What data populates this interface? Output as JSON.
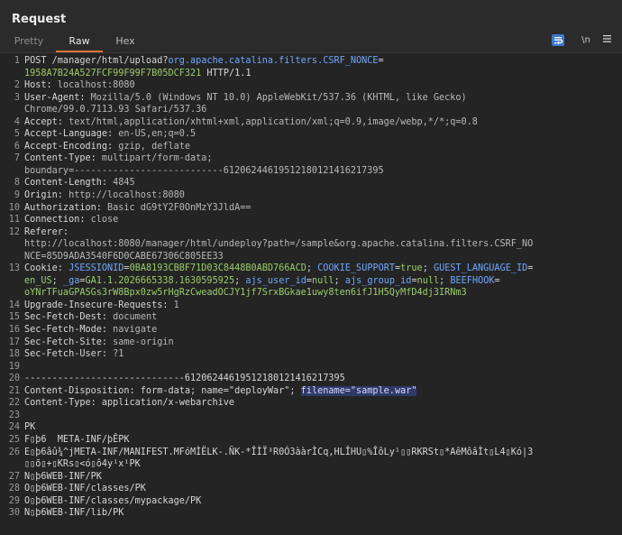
{
  "panel": {
    "title": "Request",
    "tabs": [
      "Pretty",
      "Raw",
      "Hex"
    ],
    "active_tab": "Raw",
    "newline_toggle": "\\n",
    "menu_icon": "hamburger-menu-icon",
    "wrap_icon": "word-wrap-icon"
  },
  "colors": {
    "accent": "#e8743b",
    "cookie_value": "#9acd68",
    "cookie_name": "#6fa7ff",
    "wrap_button": "#3c7ad1",
    "highlight": "#2f3a6a"
  },
  "lines": [
    {
      "n": "1",
      "parts": [
        {
          "t": "POST /manager/html/upload?"
        },
        {
          "t": "org.apache.catalina.filters.CSRF_NONCE",
          "c": "b"
        },
        {
          "t": "="
        }
      ]
    },
    {
      "n": "",
      "parts": [
        {
          "t": "1958A7B24A527FCF99F99F7B05DCF321",
          "c": "g"
        },
        {
          "t": " HTTP/1.1"
        }
      ]
    },
    {
      "n": "2",
      "parts": [
        {
          "t": "Host:",
          "c": "k"
        },
        {
          "t": " localhost:8080",
          "c": "v"
        }
      ]
    },
    {
      "n": "3",
      "parts": [
        {
          "t": "User-Agent:",
          "c": "k"
        },
        {
          "t": " Mozilla/5.0 (Windows NT 10.0) AppleWebKit/537.36 (KHTML, like Gecko)",
          "c": "v"
        }
      ]
    },
    {
      "n": "",
      "parts": [
        {
          "t": "Chrome/99.0.7113.93 Safari/537.36",
          "c": "v"
        }
      ]
    },
    {
      "n": "4",
      "parts": [
        {
          "t": "Accept:",
          "c": "k"
        },
        {
          "t": " text/html,application/xhtml+xml,application/xml;q=0.9,image/webp,*/*;q=0.8",
          "c": "v"
        }
      ]
    },
    {
      "n": "5",
      "parts": [
        {
          "t": "Accept-Language:",
          "c": "k"
        },
        {
          "t": " en-US,en;q=0.5",
          "c": "v"
        }
      ]
    },
    {
      "n": "6",
      "parts": [
        {
          "t": "Accept-Encoding:",
          "c": "k"
        },
        {
          "t": " gzip, deflate",
          "c": "v"
        }
      ]
    },
    {
      "n": "7",
      "parts": [
        {
          "t": "Content-Type:",
          "c": "k"
        },
        {
          "t": " multipart/form-data;",
          "c": "v"
        }
      ]
    },
    {
      "n": "",
      "parts": [
        {
          "t": "boundary=---------------------------6120624461951218012141621739​5",
          "c": "v"
        }
      ]
    },
    {
      "n": "8",
      "parts": [
        {
          "t": "Content-Length:",
          "c": "k"
        },
        {
          "t": " 4845",
          "c": "v"
        }
      ]
    },
    {
      "n": "9",
      "parts": [
        {
          "t": "Origin:",
          "c": "k"
        },
        {
          "t": " http://localhost:8080",
          "c": "v"
        }
      ]
    },
    {
      "n": "10",
      "parts": [
        {
          "t": "Authorization:",
          "c": "k"
        },
        {
          "t": " Basic dG9tY2F0OnMzY3JldA==",
          "c": "v"
        }
      ]
    },
    {
      "n": "11",
      "parts": [
        {
          "t": "Connection:",
          "c": "k"
        },
        {
          "t": " close",
          "c": "v"
        }
      ]
    },
    {
      "n": "12",
      "parts": [
        {
          "t": "Referer:",
          "c": "k"
        }
      ]
    },
    {
      "n": "",
      "parts": [
        {
          "t": "http://localhost:8080/manager/html/undeploy?path=/sample&org.apache.catalina.filters.CSRF_NO",
          "c": "v"
        }
      ]
    },
    {
      "n": "",
      "parts": [
        {
          "t": "NCE=85D9ADA3540F6D0CABE67306C805EE33",
          "c": "v"
        }
      ]
    },
    {
      "n": "13",
      "parts": [
        {
          "t": "Cookie:",
          "c": "k"
        },
        {
          "t": " "
        },
        {
          "t": "JSESSIONID",
          "c": "b"
        },
        {
          "t": "="
        },
        {
          "t": "0BA8193CBBF71D03C8448B0ABD766ACD",
          "c": "g"
        },
        {
          "t": "; "
        },
        {
          "t": "COOKIE_SUPPORT",
          "c": "b"
        },
        {
          "t": "="
        },
        {
          "t": "true",
          "c": "g"
        },
        {
          "t": "; "
        },
        {
          "t": "GUEST_LANGUAGE_ID",
          "c": "b"
        },
        {
          "t": "="
        }
      ]
    },
    {
      "n": "",
      "parts": [
        {
          "t": "en_US",
          "c": "g"
        },
        {
          "t": "; "
        },
        {
          "t": "_ga",
          "c": "b"
        },
        {
          "t": "="
        },
        {
          "t": "GA1.1.2026665338.1630595925",
          "c": "g"
        },
        {
          "t": "; "
        },
        {
          "t": "ajs_user_id",
          "c": "b"
        },
        {
          "t": "="
        },
        {
          "t": "null",
          "c": "g"
        },
        {
          "t": "; "
        },
        {
          "t": "ajs_group_id",
          "c": "b"
        },
        {
          "t": "="
        },
        {
          "t": "null",
          "c": "g"
        },
        {
          "t": "; "
        },
        {
          "t": "BEEFHOOK",
          "c": "b"
        },
        {
          "t": "="
        }
      ]
    },
    {
      "n": "",
      "parts": [
        {
          "t": "oYNrTFuaGPASGs3rW8Bpx0zw5rHgRzCweadOCJY1jf7SrxBGkae1uwy8ten6ifJ1H5QyMfD4dj3IRNm3",
          "c": "g"
        }
      ]
    },
    {
      "n": "14",
      "parts": [
        {
          "t": "Upgrade-Insecure-Requests:",
          "c": "k"
        },
        {
          "t": " 1",
          "c": "v"
        }
      ]
    },
    {
      "n": "15",
      "parts": [
        {
          "t": "Sec-Fetch-Dest:",
          "c": "k"
        },
        {
          "t": " document",
          "c": "v"
        }
      ]
    },
    {
      "n": "16",
      "parts": [
        {
          "t": "Sec-Fetch-Mode:",
          "c": "k"
        },
        {
          "t": " navigate",
          "c": "v"
        }
      ]
    },
    {
      "n": "17",
      "parts": [
        {
          "t": "Sec-Fetch-Site:",
          "c": "k"
        },
        {
          "t": " same-origin",
          "c": "v"
        }
      ]
    },
    {
      "n": "18",
      "parts": [
        {
          "t": "Sec-Fetch-User:",
          "c": "k"
        },
        {
          "t": " ?1",
          "c": "v"
        }
      ]
    },
    {
      "n": "19",
      "parts": []
    },
    {
      "n": "20",
      "parts": [
        {
          "t": "-----------------------------61206244619512180121416217395"
        }
      ]
    },
    {
      "n": "21",
      "parts": [
        {
          "t": "Content-Disposition: form-data; name=\"deployWar\"; "
        },
        {
          "t": "filename=\"sample.war\"",
          "c": "hl"
        }
      ]
    },
    {
      "n": "22",
      "parts": [
        {
          "t": "Content-Type: application/x-webarchive"
        }
      ]
    },
    {
      "n": "23",
      "parts": []
    },
    {
      "n": "24",
      "parts": [
        {
          "t": "PK"
        }
      ]
    },
    {
      "n": "25",
      "parts": [
        {
          "t": "F▯þ6  META-INF/þÊPK"
        }
      ]
    },
    {
      "n": "26",
      "parts": [
        {
          "t": "E▯þ6âû¾^jMETA-INF/MANIFEST.MFóMÌËLK-.ÑK-*ÎÌÏ³R0Ó3ààrÌCq,HLÎHU▯%ÎôLy¹▯▯RKRSt▯*AêMôâÌt▯L4▯Kó|3"
        }
      ]
    },
    {
      "n": "",
      "parts": [
        {
          "t": "▯▯õ▯+▯KRs▯<ó▯ô4y¹x¹PK"
        }
      ]
    },
    {
      "n": "27",
      "parts": [
        {
          "t": "N▯þ6WEB-INF/PK"
        }
      ]
    },
    {
      "n": "28",
      "parts": [
        {
          "t": "O▯þ6WEB-INF/classes/PK"
        }
      ]
    },
    {
      "n": "29",
      "parts": [
        {
          "t": "O▯þ6WEB-INF/classes/mypackage/PK"
        }
      ]
    },
    {
      "n": "30",
      "parts": [
        {
          "t": "N▯þ6WEB-INF/lib/PK"
        }
      ]
    }
  ]
}
